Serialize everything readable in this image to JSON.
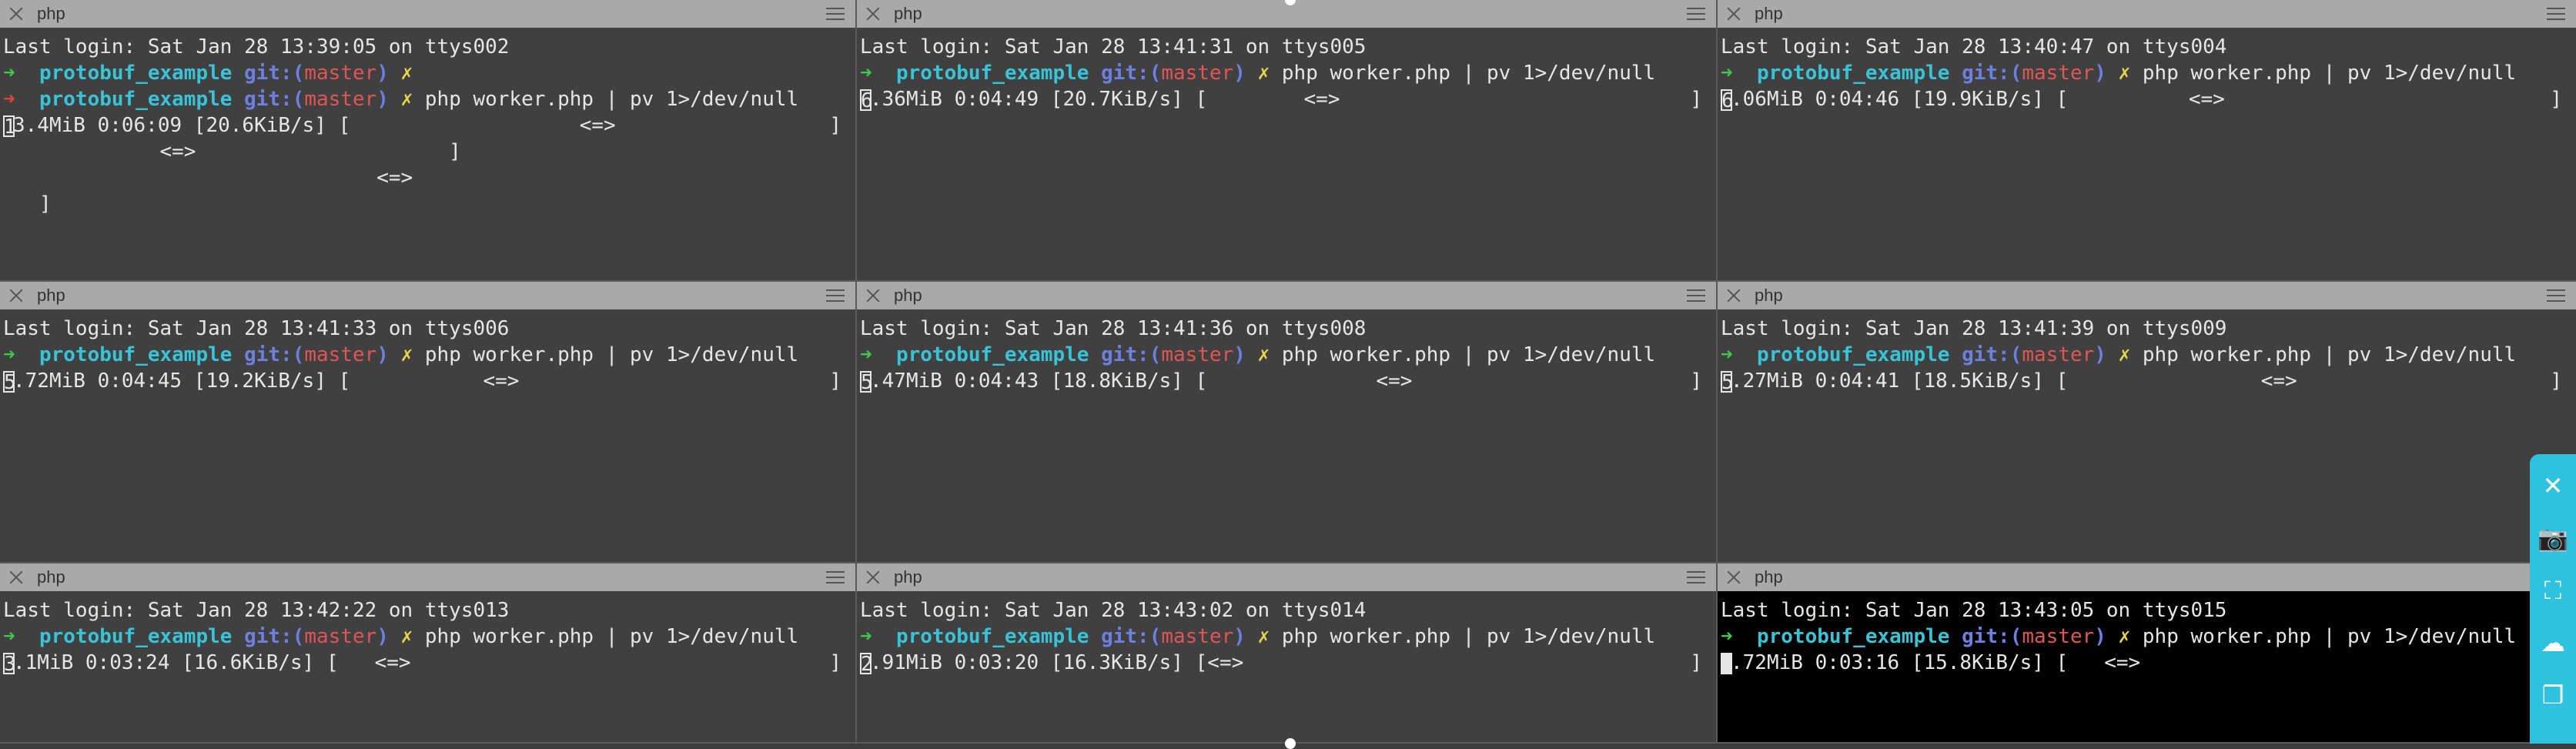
{
  "panes": [
    {
      "title": "php",
      "lines": [
        {
          "kind": "text",
          "text": "Last login: Sat Jan 28 13:39:05 on ttys002"
        },
        {
          "kind": "prompt",
          "arrow": "ok",
          "repo": "protobuf_example",
          "git": "git:(",
          "branch": "master",
          "git_close": ")",
          "x": "✗",
          "cmd": ""
        },
        {
          "kind": "prompt",
          "arrow": "err",
          "repo": "protobuf_example",
          "git": "git:(",
          "branch": "master",
          "git_close": ")",
          "x": "✗",
          "cmd": "php worker.php | pv 1>/dev/null"
        },
        {
          "kind": "pv",
          "cursor": "1",
          "text": "3.4MiB 0:06:09 [20.6KiB/s] [                   <=>",
          "end": "]"
        },
        {
          "kind": "text",
          "text": "             <=>                     ]"
        },
        {
          "kind": "text",
          "text": "                               <=>"
        },
        {
          "kind": "text",
          "text": "   ]"
        }
      ]
    },
    {
      "title": "php",
      "lines": [
        {
          "kind": "text",
          "text": "Last login: Sat Jan 28 13:41:31 on ttys005"
        },
        {
          "kind": "prompt",
          "arrow": "ok",
          "repo": "protobuf_example",
          "git": "git:(",
          "branch": "master",
          "git_close": ")",
          "x": "✗",
          "cmd": "php worker.php | pv 1>/dev/null"
        },
        {
          "kind": "pv",
          "cursor": "6",
          "text": ".36MiB 0:04:49 [20.7KiB/s] [        <=>",
          "end": "]"
        }
      ]
    },
    {
      "title": "php",
      "lines": [
        {
          "kind": "text",
          "text": "Last login: Sat Jan 28 13:40:47 on ttys004"
        },
        {
          "kind": "prompt",
          "arrow": "ok",
          "repo": "protobuf_example",
          "git": "git:(",
          "branch": "master",
          "git_close": ")",
          "x": "✗",
          "cmd": "php worker.php | pv 1>/dev/null"
        },
        {
          "kind": "pv",
          "cursor": "6",
          "text": ".06MiB 0:04:46 [19.9KiB/s] [          <=>",
          "end": "]"
        }
      ]
    },
    {
      "title": "php",
      "lines": [
        {
          "kind": "text",
          "text": "Last login: Sat Jan 28 13:41:33 on ttys006"
        },
        {
          "kind": "prompt",
          "arrow": "ok",
          "repo": "protobuf_example",
          "git": "git:(",
          "branch": "master",
          "git_close": ")",
          "x": "✗",
          "cmd": "php worker.php | pv 1>/dev/null"
        },
        {
          "kind": "pv",
          "cursor": "5",
          "text": ".72MiB 0:04:45 [19.2KiB/s] [           <=>",
          "end": "]"
        }
      ]
    },
    {
      "title": "php",
      "lines": [
        {
          "kind": "text",
          "text": "Last login: Sat Jan 28 13:41:36 on ttys008"
        },
        {
          "kind": "prompt",
          "arrow": "ok",
          "repo": "protobuf_example",
          "git": "git:(",
          "branch": "master",
          "git_close": ")",
          "x": "✗",
          "cmd": "php worker.php | pv 1>/dev/null"
        },
        {
          "kind": "pv",
          "cursor": "5",
          "text": ".47MiB 0:04:43 [18.8KiB/s] [              <=>",
          "end": "]"
        }
      ]
    },
    {
      "title": "php",
      "lines": [
        {
          "kind": "text",
          "text": "Last login: Sat Jan 28 13:41:39 on ttys009"
        },
        {
          "kind": "prompt",
          "arrow": "ok",
          "repo": "protobuf_example",
          "git": "git:(",
          "branch": "master",
          "git_close": ")",
          "x": "✗",
          "cmd": "php worker.php | pv 1>/dev/null"
        },
        {
          "kind": "pv",
          "cursor": "5",
          "text": ".27MiB 0:04:41 [18.5KiB/s] [                <=>",
          "end": "]"
        }
      ]
    },
    {
      "title": "php",
      "lines": [
        {
          "kind": "text",
          "text": "Last login: Sat Jan 28 13:42:22 on ttys013"
        },
        {
          "kind": "prompt",
          "arrow": "ok",
          "repo": "protobuf_example",
          "git": "git:(",
          "branch": "master",
          "git_close": ")",
          "x": "✗",
          "cmd": "php worker.php | pv 1>/dev/null"
        },
        {
          "kind": "pv",
          "cursor": "3",
          "text": ".1MiB 0:03:24 [16.6KiB/s] [   <=>",
          "end": "]"
        }
      ]
    },
    {
      "title": "php",
      "lines": [
        {
          "kind": "text",
          "text": "Last login: Sat Jan 28 13:43:02 on ttys014"
        },
        {
          "kind": "prompt",
          "arrow": "ok",
          "repo": "protobuf_example",
          "git": "git:(",
          "branch": "master",
          "git_close": ")",
          "x": "✗",
          "cmd": "php worker.php | pv 1>/dev/null"
        },
        {
          "kind": "pv",
          "cursor": "2",
          "text": ".91MiB 0:03:20 [16.3KiB/s] [<=>",
          "end": "]"
        }
      ]
    },
    {
      "title": "php",
      "active": true,
      "lines": [
        {
          "kind": "text",
          "text": "Last login: Sat Jan 28 13:43:05 on ttys015"
        },
        {
          "kind": "prompt",
          "arrow": "ok",
          "repo": "protobuf_example",
          "git": "git:(",
          "branch": "master",
          "git_close": ")",
          "x": "✗",
          "cmd": "php worker.php | pv 1>/dev/null"
        },
        {
          "kind": "pv",
          "cursor": "2",
          "text": ".72MiB 0:03:16 [15.8KiB/s] [   <=>",
          "end": ""
        }
      ]
    }
  ],
  "sidebar_icons": [
    "close-icon",
    "camera-icon",
    "fullscreen-icon",
    "cloud-upload-icon",
    "clipboard-icon"
  ],
  "sidebar_glyphs": [
    "✕",
    "📷",
    "⛶",
    "☁",
    "❐"
  ],
  "colors": {
    "accent": "#2ec1e0",
    "prompt_arrow": "#3ec94b",
    "error_arrow": "#e0413b",
    "repo": "#39c3d6",
    "git": "#6e7fe0",
    "branch": "#e05555",
    "dirty": "#e6d84a"
  }
}
